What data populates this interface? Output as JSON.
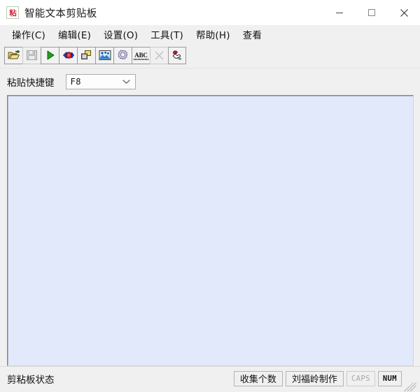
{
  "window": {
    "title": "智能文本剪贴板",
    "icon": "clipboard-paste-icon",
    "icon_glyph": "粘",
    "controls": {
      "minimize": "minimize-button",
      "maximize": "maximize-button",
      "close": "close-button"
    }
  },
  "menubar": {
    "items": [
      {
        "label": "操作(C)",
        "name": "menu-operation"
      },
      {
        "label": "编辑(E)",
        "name": "menu-edit"
      },
      {
        "label": "设置(O)",
        "name": "menu-settings"
      },
      {
        "label": "工具(T)",
        "name": "menu-tools"
      },
      {
        "label": "帮助(H)",
        "name": "menu-help"
      },
      {
        "label": "查看",
        "name": "menu-view"
      }
    ]
  },
  "toolbar": {
    "buttons": [
      {
        "icon": "open-folder-icon",
        "enabled": true
      },
      {
        "icon": "save-floppy-icon",
        "enabled": false
      },
      {
        "icon": "play-run-icon",
        "enabled": true
      },
      {
        "icon": "clipboard-capture-icon",
        "enabled": true
      },
      {
        "icon": "copy-duplicate-icon",
        "enabled": true
      },
      {
        "icon": "image-picture-icon",
        "enabled": true
      },
      {
        "icon": "settings-gear-icon",
        "enabled": true
      },
      {
        "icon": "abc-spellcheck-icon",
        "label": "ABC",
        "enabled": true
      },
      {
        "icon": "delete-x-icon",
        "enabled": false
      },
      {
        "icon": "hand-pointer-icon",
        "enabled": true
      }
    ]
  },
  "hotkey": {
    "label": "粘贴快捷键",
    "value": "F8",
    "placeholder": "F8"
  },
  "editor": {
    "content": "",
    "background": "#e2e9fb"
  },
  "statusbar": {
    "status_text": "剪粘板状态",
    "panels": [
      {
        "label": "收集个数",
        "name": "status-collect-count",
        "style": "normal"
      },
      {
        "label": "刘福岭制作",
        "name": "status-author",
        "style": "normal"
      },
      {
        "label": "CAPS",
        "name": "status-caps-lock",
        "style": "dim"
      },
      {
        "label": "NUM",
        "name": "status-num-lock",
        "style": "strong"
      }
    ]
  },
  "colors": {
    "window_bg": "#f0f0f0",
    "titlebar_bg": "#ffffff",
    "editor_bg": "#e2e9fb",
    "accent_red": "#d4243a"
  }
}
